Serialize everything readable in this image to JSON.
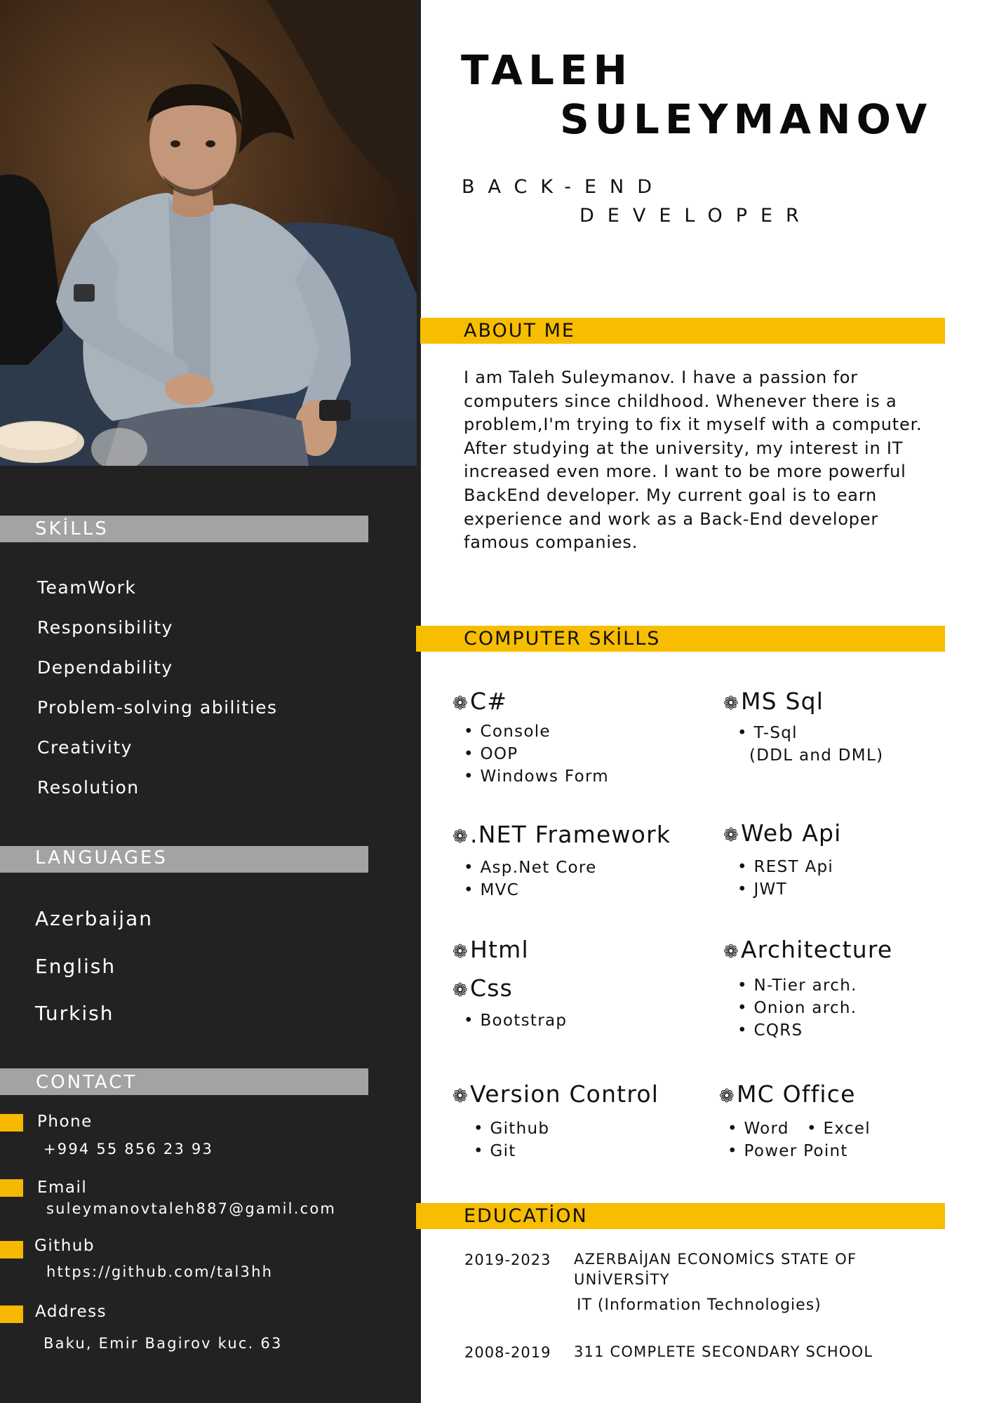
{
  "name": {
    "first": "TALEH",
    "last": "SULEYMANOV"
  },
  "role": {
    "line1": "BACK-END",
    "line2": "DEVELOPER"
  },
  "photo": {
    "alt": "Portrait photo of Taleh Suleymanov"
  },
  "sections": {
    "skills": "SKİLLS",
    "languages": "LANGUAGES",
    "contact": "CONTACT",
    "about": "ABOUT ME",
    "computer_skills": "COMPUTER SKİLLS",
    "education": "EDUCATİON"
  },
  "skills": [
    "TeamWork",
    "Responsibility",
    "Dependability",
    "Problem-solving abilities",
    "Creativity",
    "Resolution"
  ],
  "languages": [
    "Azerbaijan",
    "English",
    "Turkish"
  ],
  "contact": {
    "phone_label": "Phone",
    "phone": "+994 55 856 23 93",
    "email_label": "Email",
    "email": "suleymanovtaleh887@gamil.com",
    "github_label": "Github",
    "github": "https://github.com/tal3hh",
    "address_label": "Address",
    "address": "Baku, Emir Bagirov kuc. 63"
  },
  "about_text": "I am Taleh Suleymanov. I have a passion for computers since childhood. Whenever there is a problem,I'm trying to fix it myself with a computer. After studying at the university, my interest in IT increased even more. I want to be more powerful BackEnd developer. My current goal is to earn experience and work as a Back-End developer famous companies.",
  "computer_skills": {
    "csharp": {
      "title": "C#",
      "items": [
        "• Console",
        "• OOP",
        "• Windows Form"
      ]
    },
    "mssql": {
      "title": "MS Sql",
      "items": [
        "• T-Sql",
        "(DDL and DML)"
      ]
    },
    "dotnet": {
      "title": ".NET Framework",
      "items": [
        "• Asp.Net Core",
        "• MVC"
      ]
    },
    "webapi": {
      "title": "Web Api",
      "items": [
        "• REST Api",
        "• JWT"
      ]
    },
    "html": {
      "title": "Html"
    },
    "css": {
      "title": "Css",
      "items": [
        "• Bootstrap"
      ]
    },
    "architecture": {
      "title": "Architecture",
      "items": [
        "• N-Tier arch.",
        "• Onion arch.",
        "• CQRS"
      ]
    },
    "vcs": {
      "title": "Version Control",
      "items": [
        "• Github",
        "• Git"
      ]
    },
    "office": {
      "title": "MC Office",
      "items": [
        "• Word",
        "• Excel",
        "• Power Point"
      ]
    },
    "flower_glyph": "❁"
  },
  "education": [
    {
      "years": "2019-2023",
      "title_line1": "AZERBAİJAN ECONOMİCS STATE OF",
      "title_line2": "UNİVERSİTY",
      "field": "IT (Information Technologies)"
    },
    {
      "years": "2008-2019",
      "title_line1": "311 COMPLETE SECONDARY SCHOOL"
    }
  ],
  "colors": {
    "accent": "#f7bd00",
    "sidebar": "#222222",
    "label_bar": "#a3a3a3"
  }
}
